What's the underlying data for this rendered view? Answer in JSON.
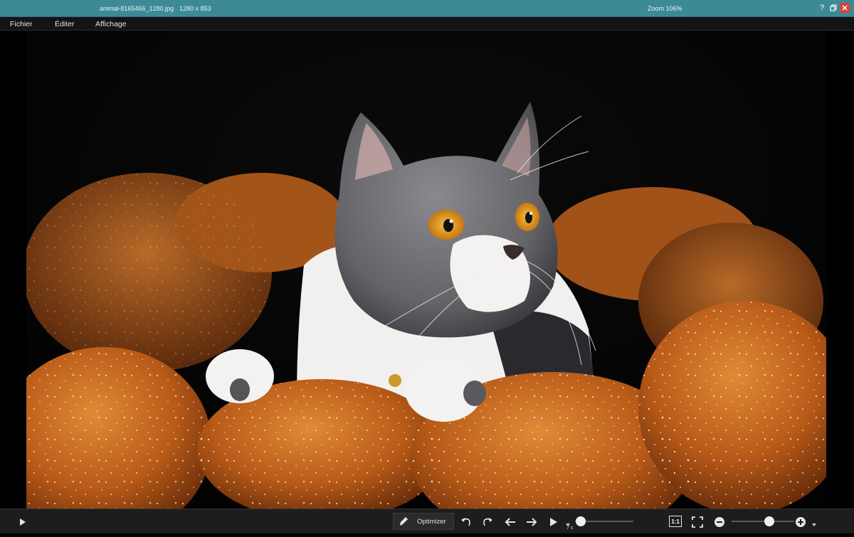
{
  "titlebar": {
    "filename": "animal-8165466_1280.jpg",
    "dimensions": "1280 x 853",
    "zoom": "Zoom 106%",
    "help_label": "?",
    "close_label": "✕"
  },
  "menu": {
    "items": [
      "Fichier",
      "Éditer",
      "Affichage"
    ]
  },
  "toolbar": {
    "optimize_label": "Optimizer",
    "one_to_one_label": "1:1",
    "speed_label": "7 s",
    "slideshow_level": 0.1,
    "zoom_level": 0.6
  },
  "icons": {
    "play": "play-icon",
    "pen": "pen-icon",
    "undo": "rotate-left-icon",
    "redo": "rotate-right-icon",
    "prev": "arrow-left-icon",
    "next": "arrow-right-icon",
    "slideshow": "slideshow-play-icon",
    "fullscreen": "fullscreen-icon",
    "zoom_out": "zoom-out-icon",
    "zoom_in": "zoom-in-icon"
  },
  "colors": {
    "titlebar": "#3d8a97",
    "close": "#d8423b",
    "pumpkin": "#c8681c",
    "cat_gray": "#6d6d70",
    "eye": "#e39a20"
  }
}
